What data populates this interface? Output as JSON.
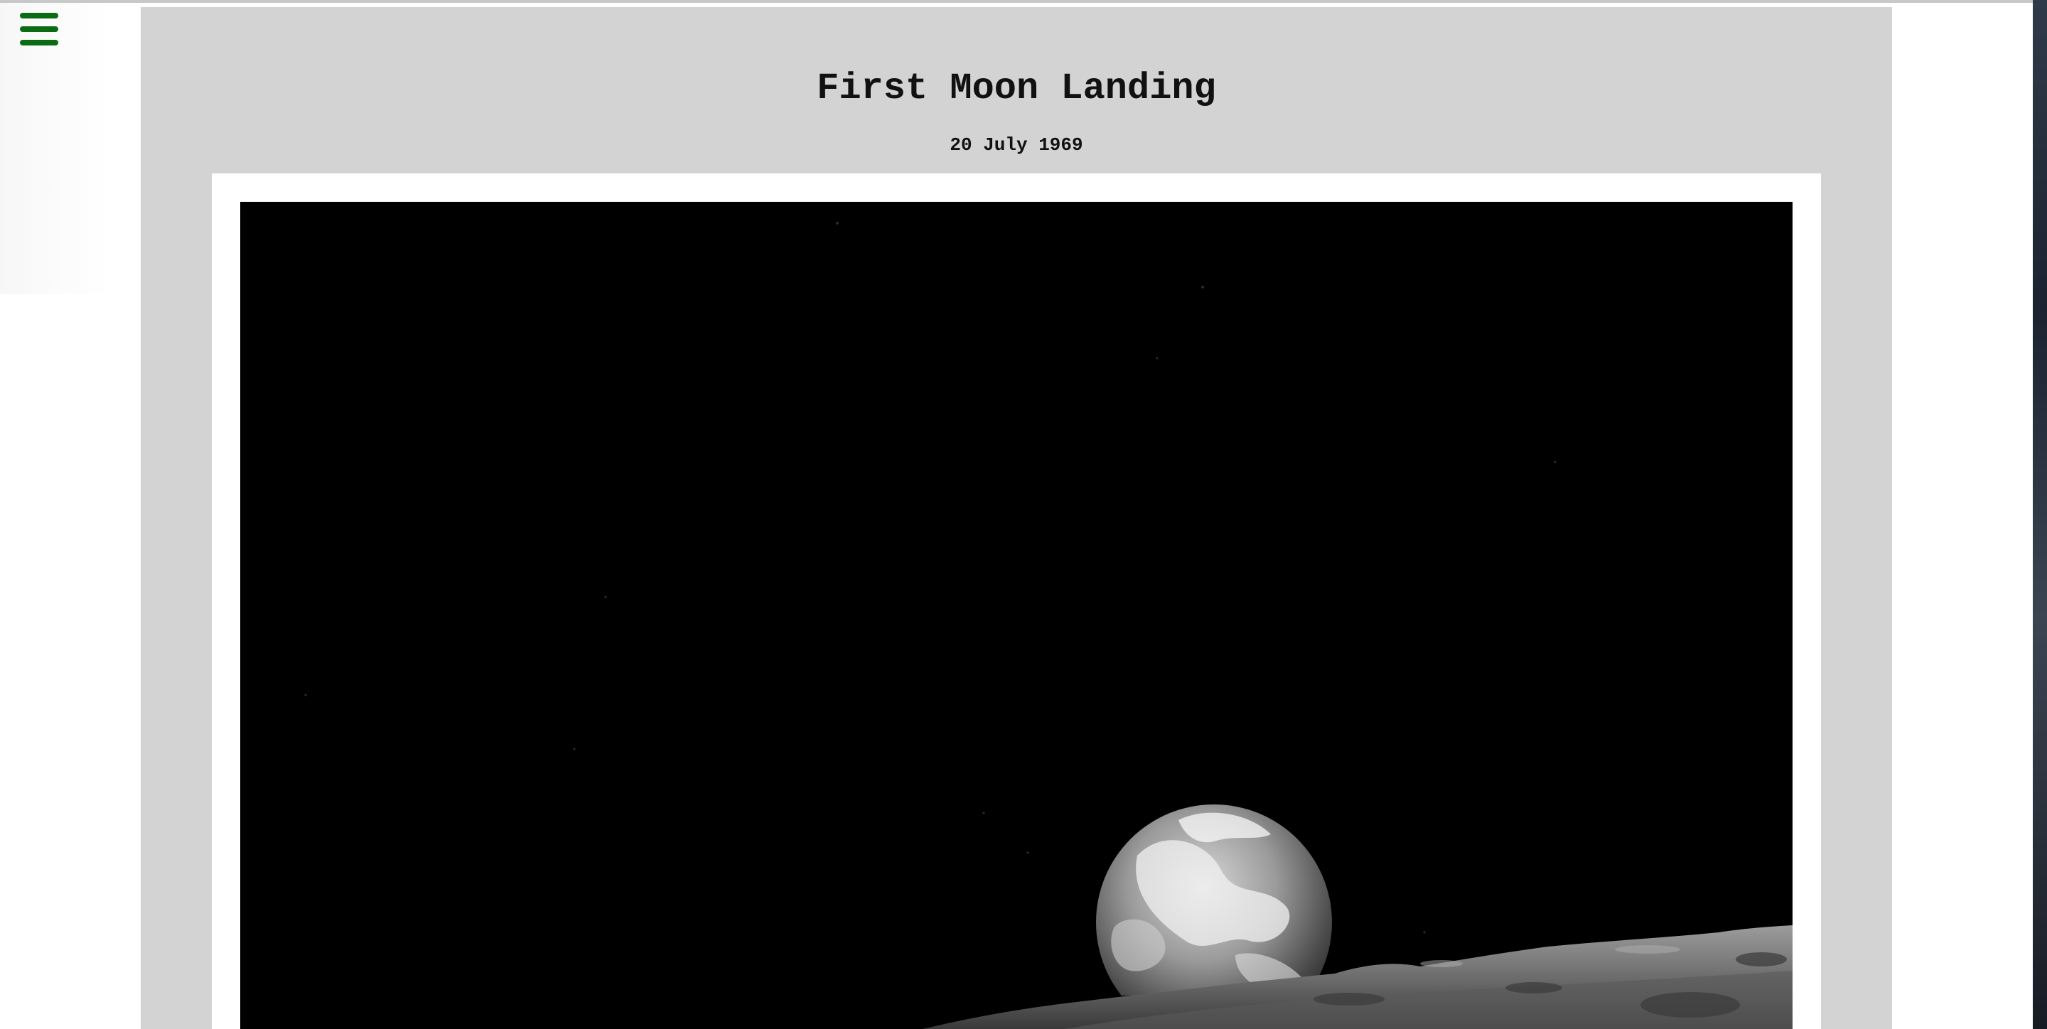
{
  "nav": {
    "menu_icon": "hamburger-menu-icon",
    "menu_color": "#0a6b14"
  },
  "article": {
    "title": "First Moon Landing",
    "date": "20 July 1969"
  },
  "photo": {
    "subject": "earth-rising-over-lunar-horizon",
    "tone": "black-and-white"
  },
  "colors": {
    "panel_bg": "#d3d3d3",
    "frame_bg": "#ffffff",
    "photo_bg": "#000000",
    "text": "#111111"
  }
}
